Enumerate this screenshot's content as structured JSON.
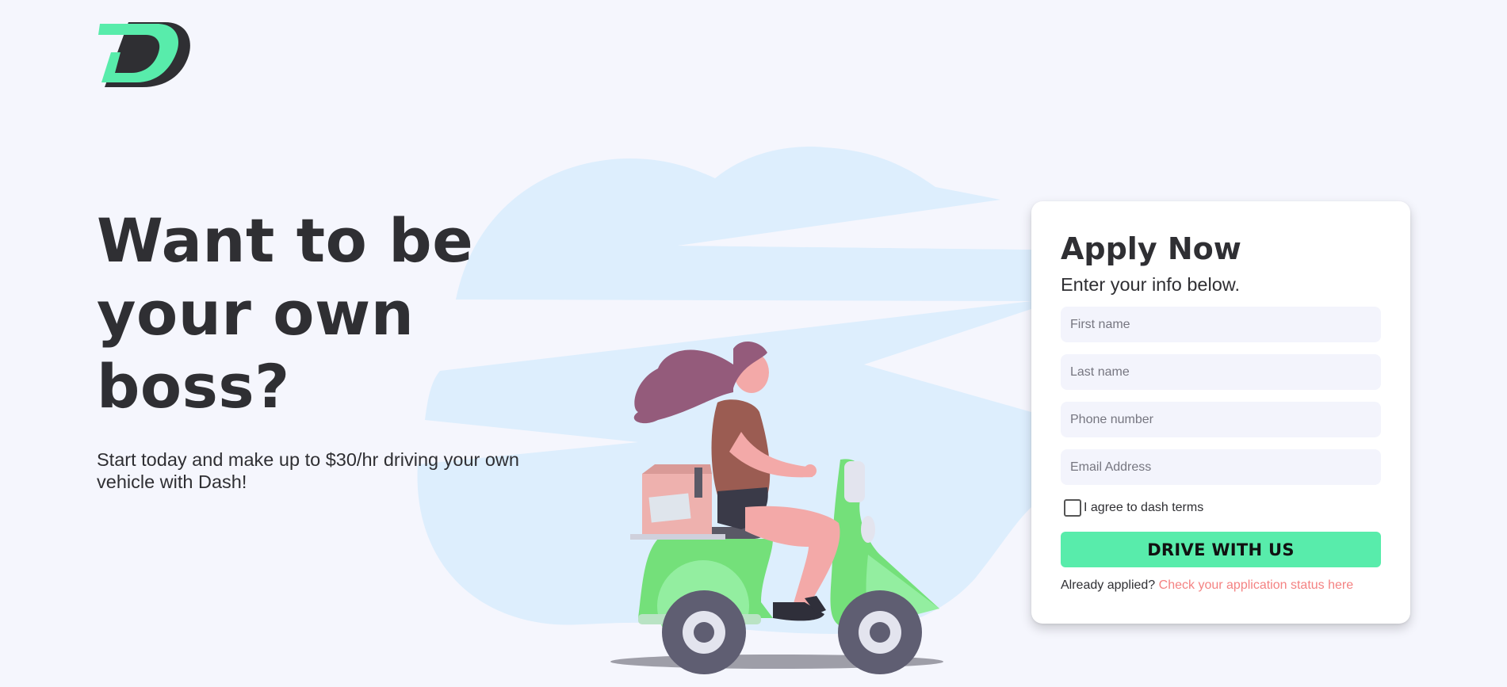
{
  "logo": {
    "name": "dash-logo",
    "colors": {
      "green": "#58ecab",
      "dark": "#2f2f33"
    }
  },
  "hero": {
    "title": "Want to be your own boss?",
    "subtitle": "Start today and make up to $30/hr driving your own vehicle with Dash!"
  },
  "form": {
    "title": "Apply Now",
    "subtitle": "Enter your info below.",
    "fields": {
      "first_name": {
        "placeholder": "First name",
        "value": ""
      },
      "last_name": {
        "placeholder": "Last name",
        "value": ""
      },
      "phone": {
        "placeholder": "Phone number",
        "value": ""
      },
      "email": {
        "placeholder": "Email Address",
        "value": ""
      }
    },
    "terms_label": "I agree to dash terms",
    "terms_checked": false,
    "submit_label": "DRIVE WITH US",
    "status_prompt": "Already applied?",
    "status_link": "Check your application status here"
  },
  "colors": {
    "accent": "#58ecab",
    "link": "#f48282",
    "background": "#f5f6fd",
    "text": "#2f2f33"
  }
}
